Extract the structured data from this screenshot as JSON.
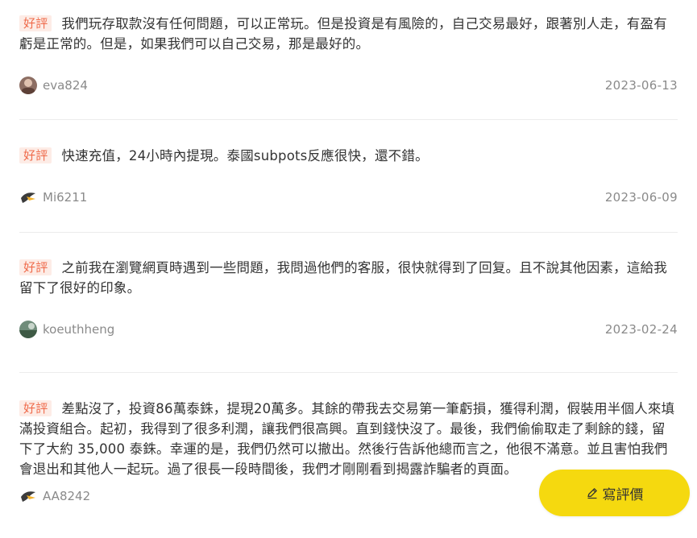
{
  "badge_label": "好評",
  "reviews": [
    {
      "text": "我們玩存取款沒有任何問題，可以正常玩。但是投資是有風險的，自己交易最好，跟著別人走，有盈有虧是正常的。但是，如果我們可以自己交易，那是最好的。",
      "username": "eva824",
      "date": "2023-06-13"
    },
    {
      "text": "快速充值，24小時內提現。泰國subpots反應很快，還不錯。",
      "username": "Mi6211",
      "date": "2023-06-09"
    },
    {
      "text": "之前我在瀏覽網頁時遇到一些問題，我問過他們的客服，很快就得到了回复。且不說其他因素，這給我留下了很好的印象。",
      "username": "koeuthheng",
      "date": "2023-02-24"
    },
    {
      "text": "差點沒了，投資86萬泰銖，提現20萬多。其餘的帶我去交易第一筆虧損，獲得利潤，假裝用半個人來填滿投資組合。起初，我得到了很多利潤，讓我們很高興。直到錢快沒了。最後，我們偷偷取走了剩餘的錢，留下了大約 35,000 泰銖。幸運的是，我們仍然可以撤出。然後行告訴他總而言之，他很不滿意。並且害怕我們會退出和其他人一起玩。過了很長一段時間後，我們才剛剛看到揭露詐騙者的頁面。",
      "username": "AA8242",
      "date": ""
    }
  ],
  "write_button": {
    "label": "寫評價",
    "icon": "pencil-icon"
  },
  "colors": {
    "badge_bg": "#fdece6",
    "badge_text": "#ef6a4a",
    "button_bg": "#f5d90f"
  }
}
